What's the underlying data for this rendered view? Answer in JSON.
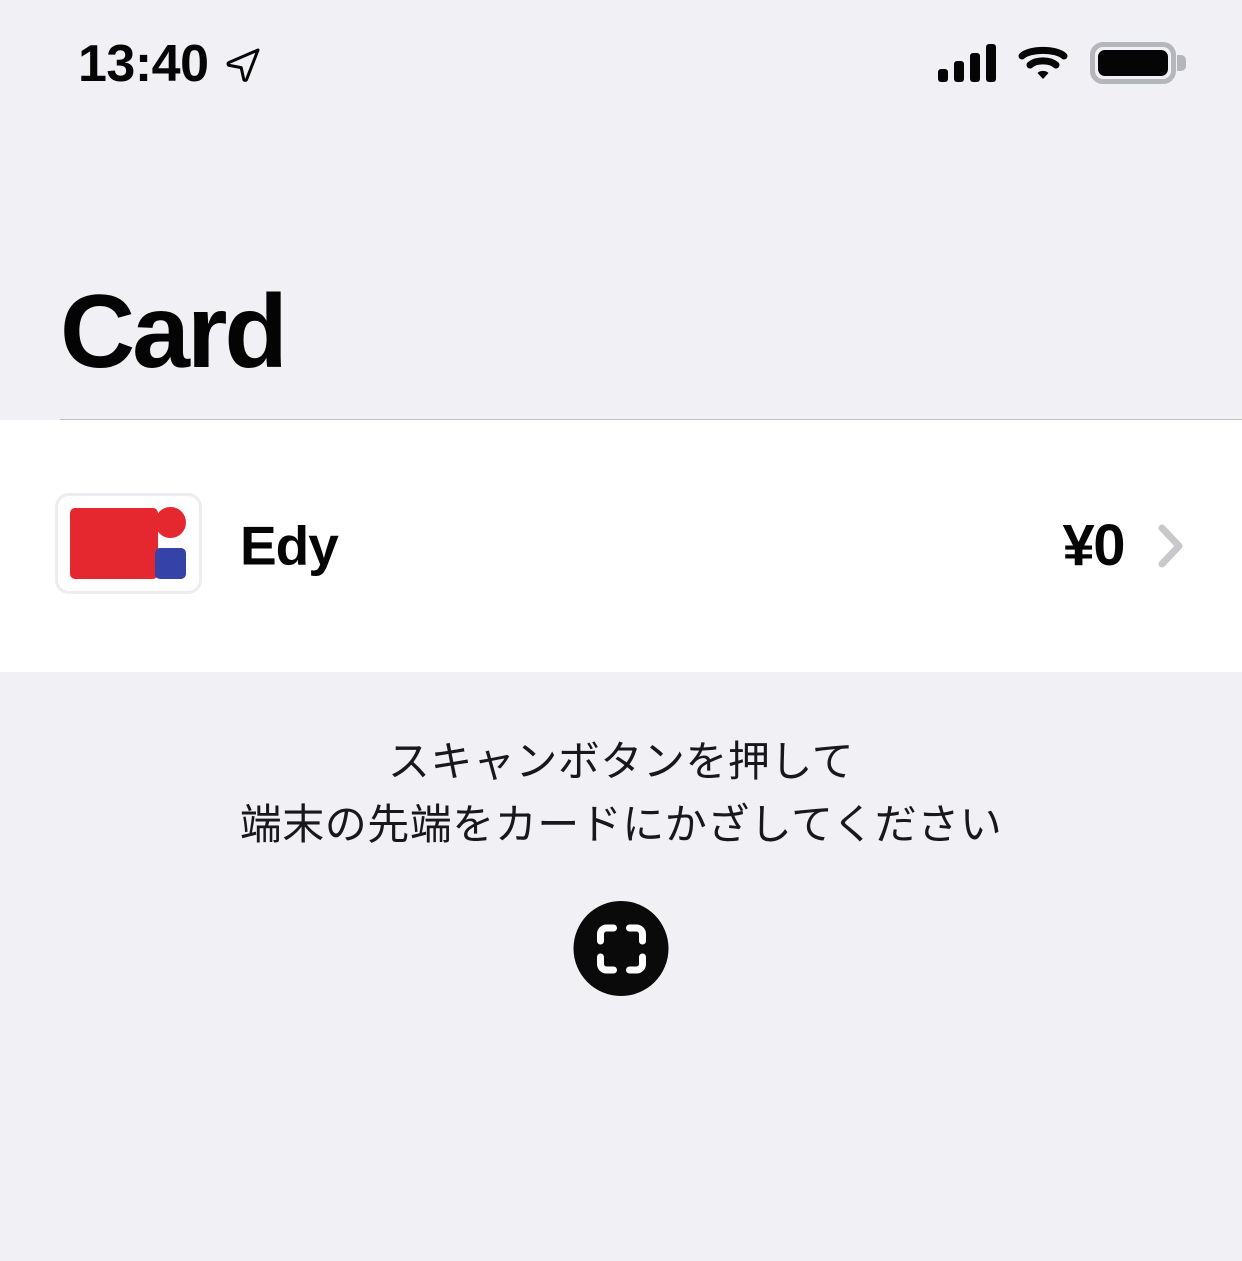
{
  "status_bar": {
    "time": "13:40",
    "location_icon": "location-arrow-icon",
    "cellular_icon": "cellular-signal-icon",
    "cellular_bars": 4,
    "wifi_icon": "wifi-icon",
    "battery_icon": "battery-icon",
    "battery_level": "full"
  },
  "header": {
    "title": "Card"
  },
  "card_list": {
    "rows": [
      {
        "logo_name": "edy-card-logo",
        "name": "Edy",
        "balance": "¥0",
        "chevron_icon": "chevron-right-icon"
      }
    ]
  },
  "scan_section": {
    "instruction_line1": "スキャンボタンを押して",
    "instruction_line2": "端末の先端をカードにかざしてください",
    "scan_button_icon": "scan-viewfinder-icon"
  },
  "colors": {
    "background": "#F1F1F5",
    "surface": "#FFFFFF",
    "text_primary": "#050505",
    "separator": "#BFBFC6",
    "chevron": "#C7C7CC",
    "logo_red": "#E5282F",
    "logo_blue": "#3543A8",
    "scan_button": "#0A0A0A"
  }
}
